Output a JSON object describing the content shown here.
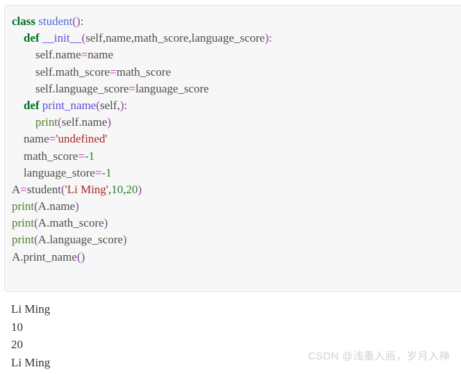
{
  "code_block": {
    "language": "python",
    "lines": [
      {
        "indent": 0,
        "tokens": [
          {
            "t": "class",
            "c": "kw"
          },
          {
            "t": " ",
            "c": "plain"
          },
          {
            "t": "student",
            "c": "cls"
          },
          {
            "t": "()",
            "c": "punc"
          },
          {
            "t": ":",
            "c": "punc"
          }
        ]
      },
      {
        "indent": 4,
        "tokens": [
          {
            "t": "def",
            "c": "kw"
          },
          {
            "t": " ",
            "c": "plain"
          },
          {
            "t": "__init__",
            "c": "fn"
          },
          {
            "t": "(",
            "c": "punc"
          },
          {
            "t": "self",
            "c": "name"
          },
          {
            "t": ",",
            "c": "name"
          },
          {
            "t": "name",
            "c": "name"
          },
          {
            "t": ",",
            "c": "name"
          },
          {
            "t": "math_score",
            "c": "name"
          },
          {
            "t": ",",
            "c": "name"
          },
          {
            "t": "language_score",
            "c": "name"
          },
          {
            "t": ")",
            "c": "punc"
          },
          {
            "t": ":",
            "c": "punc"
          }
        ]
      },
      {
        "indent": 8,
        "tokens": [
          {
            "t": "self",
            "c": "name"
          },
          {
            "t": ".",
            "c": "name"
          },
          {
            "t": "name",
            "c": "name"
          },
          {
            "t": "=",
            "c": "op"
          },
          {
            "t": "name",
            "c": "name"
          }
        ]
      },
      {
        "indent": 8,
        "tokens": [
          {
            "t": "self",
            "c": "name"
          },
          {
            "t": ".",
            "c": "name"
          },
          {
            "t": "math_score",
            "c": "name"
          },
          {
            "t": "=",
            "c": "op"
          },
          {
            "t": "math_score",
            "c": "name"
          }
        ]
      },
      {
        "indent": 8,
        "tokens": [
          {
            "t": "self",
            "c": "name"
          },
          {
            "t": ".",
            "c": "name"
          },
          {
            "t": "language_score",
            "c": "name"
          },
          {
            "t": "=",
            "c": "op"
          },
          {
            "t": "language_score",
            "c": "name"
          }
        ]
      },
      {
        "indent": 4,
        "tokens": [
          {
            "t": "def",
            "c": "kw"
          },
          {
            "t": " ",
            "c": "plain"
          },
          {
            "t": "print_name",
            "c": "fn"
          },
          {
            "t": "(",
            "c": "punc"
          },
          {
            "t": "self",
            "c": "name"
          },
          {
            "t": ",",
            "c": "name"
          },
          {
            "t": ")",
            "c": "punc"
          },
          {
            "t": ":",
            "c": "punc"
          }
        ]
      },
      {
        "indent": 8,
        "tokens": [
          {
            "t": "print",
            "c": "builtin"
          },
          {
            "t": "(",
            "c": "punc"
          },
          {
            "t": "self",
            "c": "name"
          },
          {
            "t": ".",
            "c": "name"
          },
          {
            "t": "name",
            "c": "name"
          },
          {
            "t": ")",
            "c": "punc"
          }
        ]
      },
      {
        "indent": 4,
        "tokens": [
          {
            "t": "name",
            "c": "name"
          },
          {
            "t": "=",
            "c": "op"
          },
          {
            "t": "'undefined'",
            "c": "str"
          }
        ]
      },
      {
        "indent": 4,
        "tokens": [
          {
            "t": "math_score",
            "c": "name"
          },
          {
            "t": "=",
            "c": "op"
          },
          {
            "t": "-1",
            "c": "num"
          }
        ]
      },
      {
        "indent": 4,
        "tokens": [
          {
            "t": "language_store",
            "c": "name"
          },
          {
            "t": "=",
            "c": "op"
          },
          {
            "t": "-1",
            "c": "num"
          }
        ]
      },
      {
        "indent": 0,
        "tokens": [
          {
            "t": "A",
            "c": "name"
          },
          {
            "t": "=",
            "c": "op"
          },
          {
            "t": "student",
            "c": "name"
          },
          {
            "t": "(",
            "c": "punc"
          },
          {
            "t": "'Li Ming'",
            "c": "str"
          },
          {
            "t": ",",
            "c": "name"
          },
          {
            "t": "10",
            "c": "num"
          },
          {
            "t": ",",
            "c": "name"
          },
          {
            "t": "20",
            "c": "num"
          },
          {
            "t": ")",
            "c": "punc"
          }
        ]
      },
      {
        "indent": 0,
        "tokens": [
          {
            "t": "print",
            "c": "builtin"
          },
          {
            "t": "(",
            "c": "punc"
          },
          {
            "t": "A",
            "c": "name"
          },
          {
            "t": ".",
            "c": "name"
          },
          {
            "t": "name",
            "c": "name"
          },
          {
            "t": ")",
            "c": "punc"
          }
        ]
      },
      {
        "indent": 0,
        "tokens": [
          {
            "t": "print",
            "c": "builtin"
          },
          {
            "t": "(",
            "c": "punc"
          },
          {
            "t": "A",
            "c": "name"
          },
          {
            "t": ".",
            "c": "name"
          },
          {
            "t": "math_score",
            "c": "name"
          },
          {
            "t": ")",
            "c": "punc"
          }
        ]
      },
      {
        "indent": 0,
        "tokens": [
          {
            "t": "print",
            "c": "builtin"
          },
          {
            "t": "(",
            "c": "punc"
          },
          {
            "t": "A",
            "c": "name"
          },
          {
            "t": ".",
            "c": "name"
          },
          {
            "t": "language_score",
            "c": "name"
          },
          {
            "t": ")",
            "c": "punc"
          }
        ]
      },
      {
        "indent": 0,
        "tokens": [
          {
            "t": "A",
            "c": "name"
          },
          {
            "t": ".",
            "c": "name"
          },
          {
            "t": "print_name",
            "c": "name"
          },
          {
            "t": "()",
            "c": "punc"
          }
        ]
      }
    ]
  },
  "output": {
    "lines": [
      "Li Ming",
      "10",
      "20",
      "Li Ming"
    ]
  },
  "watermark": {
    "text": "CSDN @浅墨入画，岁月入禅"
  },
  "colors": {
    "code_background": "#f7f7f7",
    "code_border": "#e3e3e3",
    "page_background": "#ffffff",
    "keyword": "#007020",
    "class_name": "#4b6cd8",
    "function_name": "#5b4fd6",
    "builtin": "#52802a",
    "punctuation": "#8a3fa0",
    "operator": "#d629b0",
    "string": "#a52a2a",
    "number": "#2f7f2f",
    "identifier": "#4d4d4d",
    "output_text": "#2f2f3a",
    "watermark": "#d2d2d2"
  }
}
